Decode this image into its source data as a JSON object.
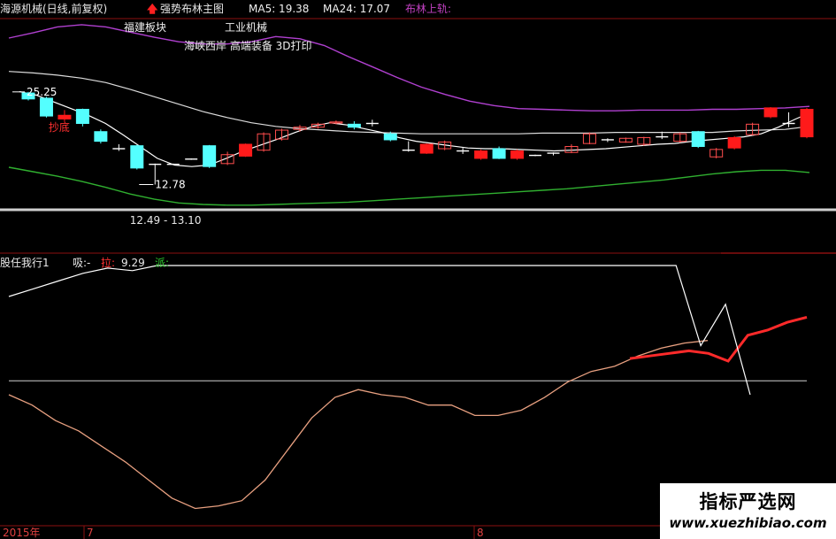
{
  "header": {
    "stock": "海源机械(日线,前复权)",
    "indicator": "强势布林主图",
    "ma5": "MA5: 19.38",
    "ma24": "MA24: 17.07",
    "boll": "布林上轨: ",
    "arrow_color": "#ff2020"
  },
  "tags": {
    "sector": "福建板块",
    "industry": "工业机械",
    "concepts": "海峡西岸 高端装备 3D打印"
  },
  "annotations": {
    "high": "25.25",
    "low_range": "12.49 - 13.10",
    "low_mark": "12.78",
    "signal": "抄底"
  },
  "lower_panel": {
    "name": "股任我行1",
    "xi": "吸:-",
    "la": "拉:",
    "la_value": "9.29",
    "pai": "派:"
  },
  "x_axis": {
    "year": "2015年",
    "m1": "7",
    "m2": "8"
  },
  "watermark": {
    "title": "指标严选网",
    "url": "www.xuezhibiao.com"
  },
  "colors": {
    "up": "#ff1a1a",
    "down": "#54ffff",
    "up_hollow": "#ff4d4d",
    "boll_upper": "#b040d0",
    "boll_mid": "#dcdcdc",
    "boll_lower": "#30b030",
    "ma": "#ffffff",
    "la_line": "#ff2a2a",
    "pai_line": "#ffffff",
    "osc": "#e8a080"
  },
  "chart_data": [
    {
      "type": "candlestick",
      "title": "强势布林主图",
      "high_mark": 25.25,
      "low_mark": 12.78,
      "candles": [
        {
          "o": 25.1,
          "c": 24.3,
          "h": 25.25,
          "l": 24.1,
          "dir": "down"
        },
        {
          "o": 24.4,
          "c": 22.0,
          "h": 24.6,
          "l": 21.8,
          "dir": "down"
        },
        {
          "o": 22.1,
          "c": 21.6,
          "h": 22.8,
          "l": 21.2,
          "dir": "up"
        },
        {
          "o": 22.9,
          "c": 21.0,
          "h": 23.0,
          "l": 20.6,
          "dir": "down"
        },
        {
          "o": 19.9,
          "c": 18.6,
          "h": 20.2,
          "l": 18.3,
          "dir": "down"
        },
        {
          "o": 17.6,
          "c": 17.6,
          "h": 18.2,
          "l": 17.3,
          "dir": "flat"
        },
        {
          "o": 18.0,
          "c": 15.0,
          "h": 18.1,
          "l": 14.8,
          "dir": "down"
        },
        {
          "o": 15.5,
          "c": 15.4,
          "h": 15.6,
          "l": 12.78,
          "dir": "flat"
        },
        {
          "o": 15.5,
          "c": 15.5,
          "h": 15.6,
          "l": 15.4,
          "dir": "flat"
        },
        {
          "o": 16.2,
          "c": 16.2,
          "h": 16.3,
          "l": 16.1,
          "dir": "flat"
        },
        {
          "o": 18.0,
          "c": 15.2,
          "h": 18.1,
          "l": 15.0,
          "dir": "down"
        },
        {
          "o": 15.6,
          "c": 16.8,
          "h": 17.2,
          "l": 15.4,
          "dir": "uph"
        },
        {
          "o": 16.6,
          "c": 18.2,
          "h": 18.3,
          "l": 16.5,
          "dir": "up"
        },
        {
          "o": 17.4,
          "c": 19.6,
          "h": 19.8,
          "l": 17.2,
          "dir": "uph"
        },
        {
          "o": 18.9,
          "c": 20.1,
          "h": 20.3,
          "l": 18.7,
          "dir": "uph"
        },
        {
          "o": 20.2,
          "c": 20.5,
          "h": 20.8,
          "l": 19.9,
          "dir": "uph"
        },
        {
          "o": 20.5,
          "c": 20.9,
          "h": 21.1,
          "l": 20.3,
          "dir": "uph"
        },
        {
          "o": 21.1,
          "c": 21.2,
          "h": 21.4,
          "l": 20.9,
          "dir": "uph"
        },
        {
          "o": 20.9,
          "c": 20.5,
          "h": 21.3,
          "l": 20.2,
          "dir": "down"
        },
        {
          "o": 21.0,
          "c": 21.0,
          "h": 21.5,
          "l": 20.6,
          "dir": "flat"
        },
        {
          "o": 19.6,
          "c": 18.8,
          "h": 19.9,
          "l": 18.6,
          "dir": "down"
        },
        {
          "o": 17.4,
          "c": 17.4,
          "h": 18.6,
          "l": 17.2,
          "dir": "flat"
        },
        {
          "o": 17.0,
          "c": 18.2,
          "h": 18.3,
          "l": 16.9,
          "dir": "up"
        },
        {
          "o": 17.6,
          "c": 18.5,
          "h": 18.7,
          "l": 17.4,
          "dir": "uph"
        },
        {
          "o": 17.2,
          "c": 17.3,
          "h": 17.7,
          "l": 16.9,
          "dir": "flat"
        },
        {
          "o": 16.3,
          "c": 17.3,
          "h": 17.5,
          "l": 16.1,
          "dir": "up"
        },
        {
          "o": 17.6,
          "c": 16.3,
          "h": 17.9,
          "l": 16.2,
          "dir": "down"
        },
        {
          "o": 16.3,
          "c": 17.3,
          "h": 17.5,
          "l": 16.1,
          "dir": "up"
        },
        {
          "o": 16.7,
          "c": 16.7,
          "h": 16.8,
          "l": 16.6,
          "dir": "flat"
        },
        {
          "o": 16.8,
          "c": 17.0,
          "h": 17.1,
          "l": 16.7,
          "dir": "flat"
        },
        {
          "o": 17.1,
          "c": 17.9,
          "h": 18.2,
          "l": 17.0,
          "dir": "uph"
        },
        {
          "o": 18.3,
          "c": 19.6,
          "h": 19.8,
          "l": 18.2,
          "dir": "uph"
        },
        {
          "o": 18.7,
          "c": 18.8,
          "h": 19.0,
          "l": 18.5,
          "dir": "flat"
        },
        {
          "o": 18.5,
          "c": 19.0,
          "h": 19.1,
          "l": 18.4,
          "dir": "uph"
        },
        {
          "o": 18.2,
          "c": 19.1,
          "h": 19.2,
          "l": 18.0,
          "dir": "uph"
        },
        {
          "o": 19.2,
          "c": 19.2,
          "h": 19.9,
          "l": 18.9,
          "dir": "flat"
        },
        {
          "o": 18.6,
          "c": 19.6,
          "h": 19.8,
          "l": 18.4,
          "dir": "uph"
        },
        {
          "o": 19.9,
          "c": 17.9,
          "h": 20.0,
          "l": 17.7,
          "dir": "down"
        },
        {
          "o": 16.5,
          "c": 17.5,
          "h": 17.7,
          "l": 16.3,
          "dir": "uph"
        },
        {
          "o": 17.7,
          "c": 19.1,
          "h": 19.3,
          "l": 17.5,
          "dir": "up"
        },
        {
          "o": 19.5,
          "c": 20.9,
          "h": 21.1,
          "l": 19.4,
          "dir": "uph"
        },
        {
          "o": 21.9,
          "c": 23.1,
          "h": 23.2,
          "l": 21.7,
          "dir": "up"
        },
        {
          "o": 21.0,
          "c": 21.0,
          "h": 22.5,
          "l": 20.5,
          "dir": "flat"
        },
        {
          "o": 19.2,
          "c": 22.9,
          "h": 23.1,
          "l": 19.0,
          "dir": "up"
        }
      ],
      "boll_upper": [
        32.5,
        33.2,
        34.0,
        34.3,
        34.0,
        33.3,
        32.6,
        32.0,
        31.7,
        31.7,
        32.0,
        32.7,
        32.4,
        31.5,
        30.0,
        28.6,
        27.2,
        25.9,
        24.9,
        24.0,
        23.4,
        23.0,
        22.9,
        22.8,
        22.7,
        22.7,
        22.8,
        22.8,
        22.8,
        22.9,
        22.9,
        23.0,
        23.1,
        23.3
      ],
      "boll_mid": [
        28.0,
        27.8,
        27.5,
        27.1,
        26.5,
        25.6,
        24.6,
        23.6,
        22.6,
        21.8,
        21.1,
        20.6,
        20.3,
        20.1,
        19.9,
        19.8,
        19.7,
        19.6,
        19.6,
        19.6,
        19.6,
        19.6,
        19.7,
        19.7,
        19.7,
        19.8,
        19.8,
        19.8,
        19.8,
        19.8,
        20.0,
        20.1,
        20.2,
        20.6
      ],
      "boll_lower": [
        15.1,
        14.5,
        13.9,
        13.2,
        12.4,
        11.5,
        10.8,
        10.3,
        10.1,
        10.0,
        10.0,
        10.1,
        10.2,
        10.3,
        10.4,
        10.6,
        10.8,
        11.0,
        11.2,
        11.4,
        11.6,
        11.8,
        12.0,
        12.2,
        12.5,
        12.8,
        13.1,
        13.4,
        13.8,
        14.2,
        14.5,
        14.7,
        14.7,
        14.4
      ],
      "ma": [
        25.3,
        24.8,
        23.9,
        23.0,
        22.1,
        21.0,
        19.5,
        17.9,
        16.3,
        15.4,
        15.2,
        15.4,
        16.3,
        17.3,
        18.1,
        18.9,
        19.8,
        20.6,
        21.1,
        20.8,
        20.3,
        19.8,
        19.1,
        18.6,
        18.3,
        18.0,
        17.7,
        17.6,
        17.6,
        17.5,
        17.4,
        17.3,
        17.4,
        17.5,
        17.6,
        17.8,
        18.0,
        18.2,
        18.3,
        18.6,
        18.8,
        19.0,
        19.2,
        19.6,
        20.5,
        21.6,
        22.6
      ],
      "ylim": [
        9.5,
        35
      ]
    },
    {
      "type": "line",
      "title": "股任我行1",
      "ylim": [
        0,
        100
      ],
      "reference": 55.4,
      "osc": [
        50,
        46,
        40,
        36,
        30,
        24,
        17,
        10,
        6,
        7,
        9,
        17,
        29,
        41,
        49,
        52,
        50,
        49,
        46,
        46,
        42,
        42,
        44,
        49,
        55,
        59,
        61,
        65,
        68,
        70,
        71
      ],
      "la": [
        64,
        65,
        66,
        67,
        66,
        63,
        73,
        75,
        78,
        80
      ],
      "pai": [
        88,
        91,
        94,
        97,
        99,
        98,
        100,
        100,
        100,
        100,
        100,
        100,
        100,
        100,
        100,
        100,
        100,
        100,
        100,
        100,
        100,
        100,
        100,
        100,
        100,
        100,
        100,
        100,
        69,
        85,
        50
      ]
    }
  ]
}
